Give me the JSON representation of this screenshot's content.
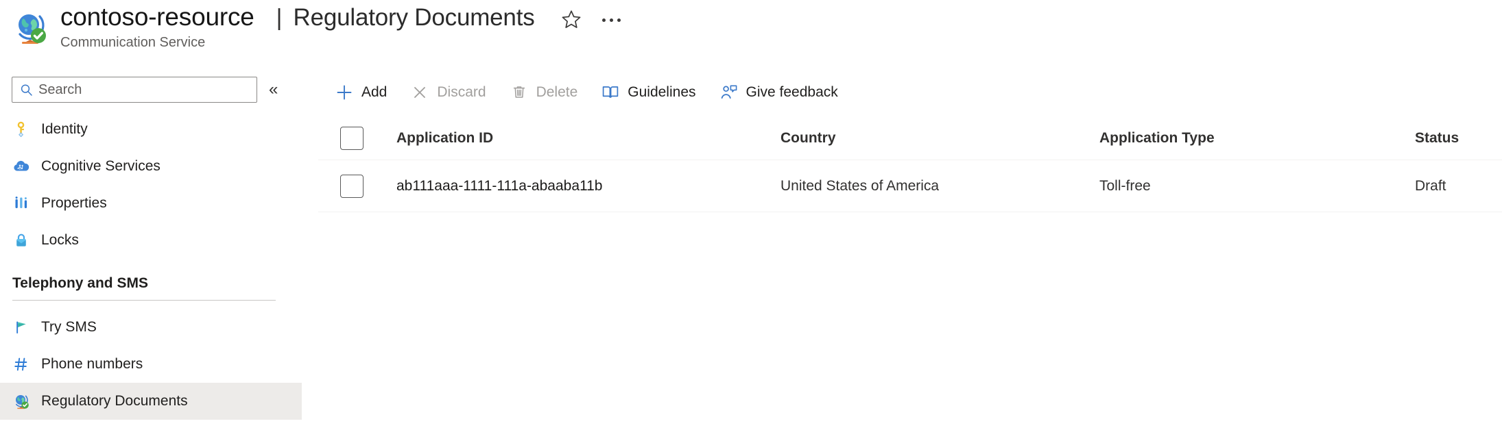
{
  "header": {
    "resource_icon": "globe-check-icon",
    "resource_name": "contoso-resource",
    "separator": "|",
    "page_title": "Regulatory Documents",
    "resource_subtitle": "Communication Service",
    "favorite_icon": "star-icon",
    "more_icon": "ellipsis-icon"
  },
  "sidebar": {
    "search": {
      "icon": "search-icon",
      "placeholder": "Search",
      "value": ""
    },
    "collapse_icon": "chevron-double-left-icon",
    "collapse_glyph": "«",
    "items": [
      {
        "label": "Identity",
        "icon": "key-icon",
        "selected": false
      },
      {
        "label": "Cognitive Services",
        "icon": "cloud-brain-icon",
        "selected": false
      },
      {
        "label": "Properties",
        "icon": "properties-bars-icon",
        "selected": false
      },
      {
        "label": "Locks",
        "icon": "lock-icon",
        "selected": false
      }
    ],
    "section": {
      "title": "Telephony and SMS",
      "items": [
        {
          "label": "Try SMS",
          "icon": "flag-icon",
          "selected": false
        },
        {
          "label": "Phone numbers",
          "icon": "hash-icon",
          "selected": false
        },
        {
          "label": "Regulatory Documents",
          "icon": "globe-check-icon",
          "selected": true
        }
      ]
    }
  },
  "toolbar": {
    "buttons": [
      {
        "label": "Add",
        "icon": "plus-icon",
        "disabled": false
      },
      {
        "label": "Discard",
        "icon": "close-x-icon",
        "disabled": true
      },
      {
        "label": "Delete",
        "icon": "trash-icon",
        "disabled": true
      },
      {
        "label": "Guidelines",
        "icon": "book-icon",
        "disabled": false
      },
      {
        "label": "Give feedback",
        "icon": "person-feedback-icon",
        "disabled": false
      }
    ]
  },
  "table": {
    "select_all_checked": false,
    "columns": [
      "Application ID",
      "Country",
      "Application Type",
      "Status"
    ],
    "rows": [
      {
        "checked": false,
        "application_id": "ab111aaa-1111-111a-abaaba11b",
        "country": "United States of America",
        "application_type": "Toll-free",
        "status": "Draft"
      }
    ]
  },
  "colors": {
    "accent_blue": "#3b79c9",
    "disabled_grey": "#a19f9d",
    "selected_row_bg": "#edebe9",
    "text_primary": "#201f1e",
    "text_secondary": "#605e5c"
  }
}
